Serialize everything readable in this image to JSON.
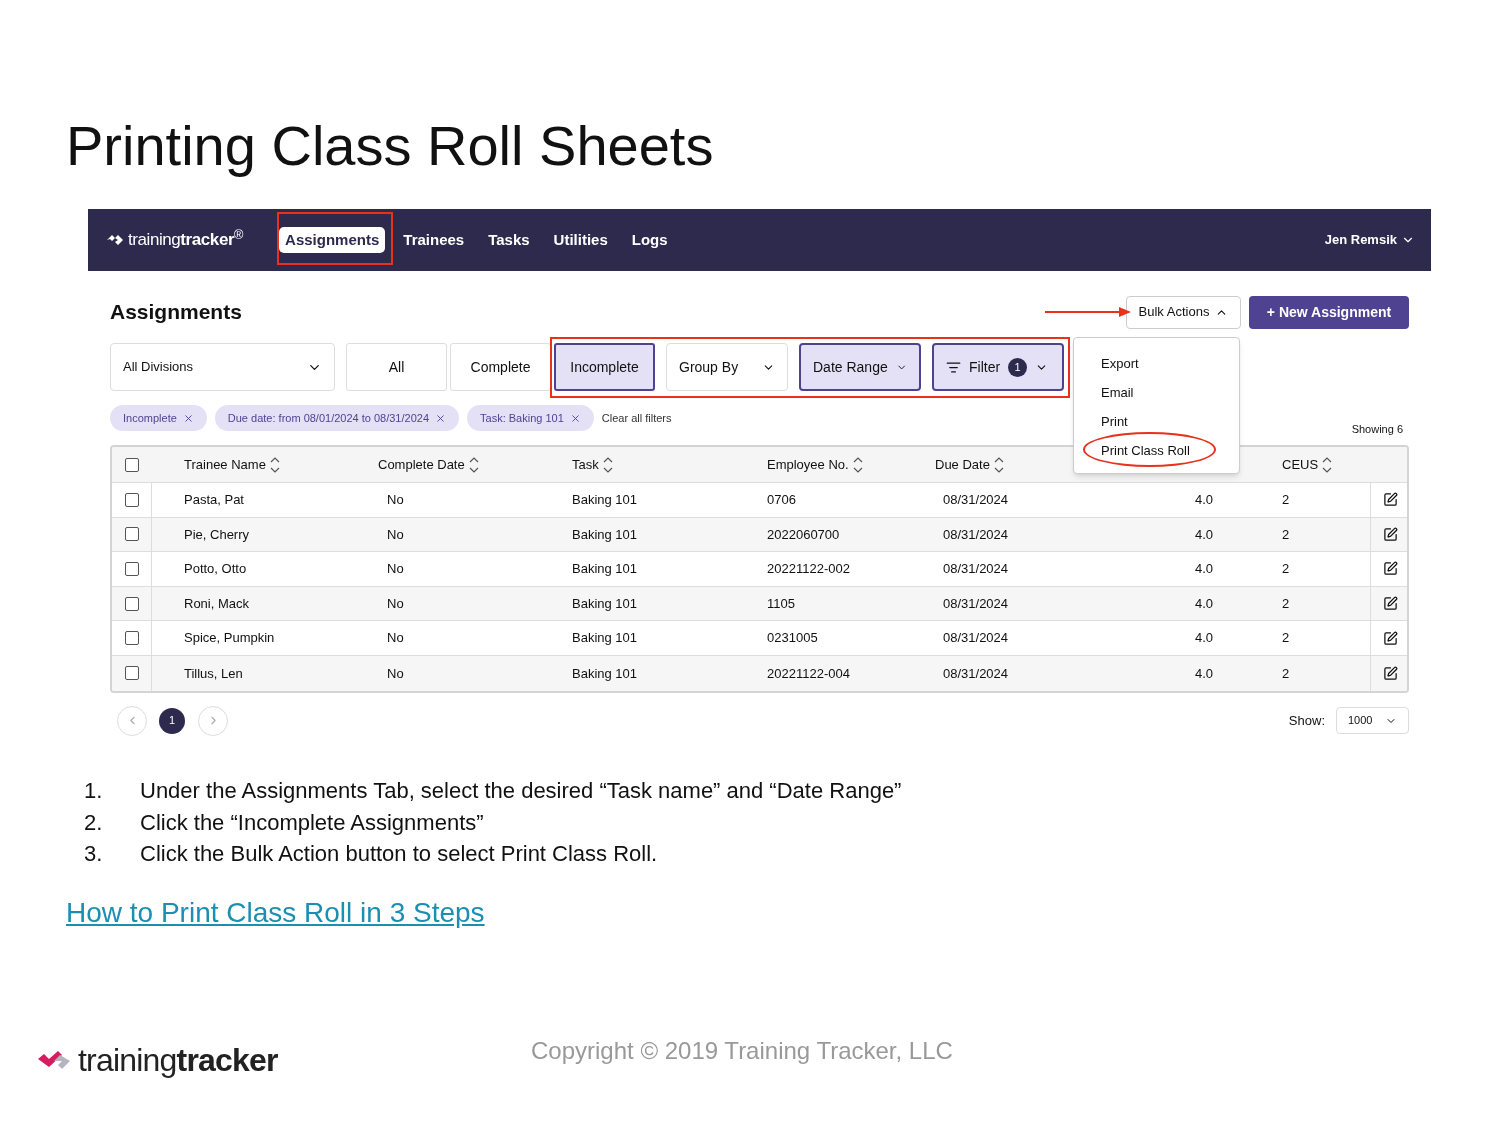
{
  "slide": {
    "title": "Printing Class Roll Sheets"
  },
  "app": {
    "nav": {
      "logo": "training**tracker**$^{®}$",
      "tabs": [
        {
          "label": "Assignments",
          "selected": true
        },
        {
          "label": "Trainees",
          "selected": false
        },
        {
          "label": "Tasks",
          "selected": false
        },
        {
          "label": "Utilities",
          "selected": false
        },
        {
          "label": "Logs",
          "selected": false
        }
      ],
      "user": "Jen Remsik"
    },
    "page_title": "Assignments",
    "bulk_actions": {
      "label": "Bulk Actions",
      "expanded": true,
      "menu": [
        {
          "label": "Export"
        },
        {
          "label": "Email"
        },
        {
          "label": "Print"
        },
        {
          "label": "Print Class Roll"
        }
      ]
    },
    "new_button": "+ New Assignment",
    "division_select": "All Divisions",
    "status_tabs": [
      {
        "label": "All",
        "selected": false
      },
      {
        "label": "Complete",
        "selected": false
      },
      {
        "label": "Incomplete",
        "selected": true
      }
    ],
    "dropdowns": [
      {
        "kind": "plain",
        "label": "Group By",
        "active": false
      },
      {
        "kind": "plain",
        "label": "Date Range",
        "active": true
      },
      {
        "kind": "filter",
        "label": "Filter",
        "active": true,
        "badge": "1"
      }
    ],
    "chips": [
      "Incomplete",
      "Due date: from 08/01/2024 to 08/31/2024",
      "Task: Baking 101"
    ],
    "clear_filters": "Clear all filters",
    "showing": "Showing 6",
    "table": {
      "header_checked": false,
      "columns": [
        {
          "kind": "label",
          "label": "Trainee Name"
        },
        {
          "kind": "label",
          "label": "Complete Date"
        },
        {
          "kind": "label",
          "label": "Task"
        },
        {
          "kind": "label",
          "label": "Employee No."
        },
        {
          "kind": "label",
          "label": "Due Date"
        },
        {
          "kind": "covered"
        },
        {
          "kind": "label",
          "label": "CEUS"
        }
      ],
      "rows": [
        {
          "checked": false,
          "cells": [
            "Pasta, Pat",
            "No",
            "Baking 101",
            "0706",
            "08/31/2024",
            "4.0",
            "2"
          ]
        },
        {
          "checked": false,
          "cells": [
            "Pie, Cherry",
            "No",
            "Baking 101",
            "2022060700",
            "08/31/2024",
            "4.0",
            "2"
          ]
        },
        {
          "checked": false,
          "cells": [
            "Potto, Otto",
            "No",
            "Baking 101",
            "20221122-002",
            "08/31/2024",
            "4.0",
            "2"
          ]
        },
        {
          "checked": false,
          "cells": [
            "Roni, Mack",
            "No",
            "Baking 101",
            "1105",
            "08/31/2024",
            "4.0",
            "2"
          ]
        },
        {
          "checked": false,
          "cells": [
            "Spice, Pumpkin",
            "No",
            "Baking 101",
            "0231005",
            "08/31/2024",
            "4.0",
            "2"
          ]
        },
        {
          "checked": false,
          "cells": [
            "Tillus, Len",
            "No",
            "Baking 101",
            "20221122-004",
            "08/31/2024",
            "4.0",
            "2"
          ]
        }
      ]
    },
    "pagination": {
      "pages": [
        {
          "label": "1",
          "selected": true
        }
      ],
      "show_label": "Show:",
      "page_size": "1000"
    }
  },
  "steps": [
    {
      "number": "1.",
      "text": "Under the Assignments Tab, select the desired “Task name” and “Date Range”"
    },
    {
      "number": "2.",
      "text": "Click the “Incomplete Assignments”"
    },
    {
      "number": "3.",
      "text": "Click the Bulk Action button to select Print Class Roll."
    }
  ],
  "link": "How to Print Class Roll in 3 Steps",
  "footer": {
    "logo": "training**tracker**",
    "copyright": "Copyright © 2019 Training Tracker, LLC"
  }
}
